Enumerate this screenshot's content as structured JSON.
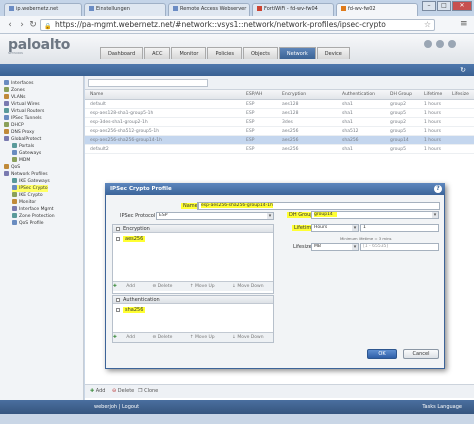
{
  "browser": {
    "tabs": [
      {
        "label": "ip.webernetz.net"
      },
      {
        "label": "Einstellungen"
      },
      {
        "label": "Remote Access Webserver"
      },
      {
        "label": "FortiWiFi - fd-wv-fw04"
      },
      {
        "label": "fd-wv-fw02"
      }
    ],
    "url": "https://pa-mgmt.webernetz.net/#network::vsys1::network/network-profiles/ipsec-crypto"
  },
  "app": {
    "logo_main": "paloalto",
    "logo_sub": "NETWORKS",
    "nav_tabs": [
      "Dashboard",
      "ACC",
      "Monitor",
      "Policies",
      "Objects",
      "Network",
      "Device"
    ],
    "active_tab": "Network"
  },
  "tree": [
    {
      "label": "Interfaces",
      "indent": 0
    },
    {
      "label": "Zones",
      "indent": 0
    },
    {
      "label": "VLANs",
      "indent": 0
    },
    {
      "label": "Virtual Wires",
      "indent": 0
    },
    {
      "label": "Virtual Routers",
      "indent": 0
    },
    {
      "label": "IPSec Tunnels",
      "indent": 0
    },
    {
      "label": "DHCP",
      "indent": 0
    },
    {
      "label": "DNS Proxy",
      "indent": 0
    },
    {
      "label": "GlobalProtect",
      "indent": 0
    },
    {
      "label": "Portals",
      "indent": 1
    },
    {
      "label": "Gateways",
      "indent": 1
    },
    {
      "label": "MDM",
      "indent": 1
    },
    {
      "label": "QoS",
      "indent": 0
    },
    {
      "label": "Network Profiles",
      "indent": 0
    },
    {
      "label": "IKE Gateways",
      "indent": 1
    },
    {
      "label": "IPSec Crypto",
      "indent": 1,
      "selected": true
    },
    {
      "label": "IKE Crypto",
      "indent": 1
    },
    {
      "label": "Monitor",
      "indent": 1
    },
    {
      "label": "Interface Mgmt",
      "indent": 1
    },
    {
      "label": "Zone Protection",
      "indent": 1
    },
    {
      "label": "QoS Profile",
      "indent": 1
    }
  ],
  "grid": {
    "headers": [
      "Name",
      "ESP/AH",
      "Encryption",
      "Authentication",
      "DH Group",
      "Lifetime",
      "Lifesize"
    ],
    "rows": [
      {
        "name": "default",
        "esp": "ESP",
        "enc": "aes128",
        "auth": "sha1",
        "dh": "group2",
        "life": "1 hours",
        "sel": false
      },
      {
        "name": "esp-aes128-sha1-group5-1h",
        "esp": "ESP",
        "enc": "aes128",
        "auth": "sha1",
        "dh": "group5",
        "life": "1 hours",
        "sel": false
      },
      {
        "name": "esp-3des-sha1-group2-1h",
        "esp": "ESP",
        "enc": "3des",
        "auth": "sha1",
        "dh": "group2",
        "life": "1 hours",
        "sel": false
      },
      {
        "name": "esp-aes256-sha512-group5-1h",
        "esp": "ESP",
        "enc": "aes256",
        "auth": "sha512",
        "dh": "group5",
        "life": "1 hours",
        "sel": false
      },
      {
        "name": "esp-aes256-sha256-group14-1h",
        "esp": "ESP",
        "enc": "aes256",
        "auth": "sha256",
        "dh": "group14",
        "life": "1 hours",
        "sel": true
      },
      {
        "name": "default2",
        "esp": "ESP",
        "enc": "aes256",
        "auth": "sha1",
        "dh": "group5",
        "life": "1 hours",
        "sel": false
      }
    ]
  },
  "actions": [
    "Add",
    "Delete",
    "Clone"
  ],
  "status": {
    "user": "weberjoh | Logout",
    "tasks": "Tasks  Language"
  },
  "dialog": {
    "title": "IPSec Crypto Profile",
    "name_label": "Name",
    "name_value": "esp-aes256-sha256-group14-1h",
    "protocol_label": "IPSec Protocol",
    "protocol_value": "ESP",
    "encryption_header": "Encryption",
    "encryption_items": [
      "aes256"
    ],
    "authentication_header": "Authentication",
    "authentication_items": [
      "sha256"
    ],
    "list_actions": [
      "Add",
      "Delete",
      "Move Up",
      "Move Down"
    ],
    "dh_label": "DH Group",
    "dh_value": "group14",
    "lifetime_label": "Lifetime",
    "lifetime_unit": "Hours",
    "lifetime_value": "1",
    "lifetime_hint": "Minimum lifetime = 3 mins",
    "lifesize_label": "Lifesize",
    "lifesize_unit": "MB",
    "lifesize_hint": "[1 - 65535]",
    "ok_label": "OK",
    "cancel_label": "Cancel"
  }
}
